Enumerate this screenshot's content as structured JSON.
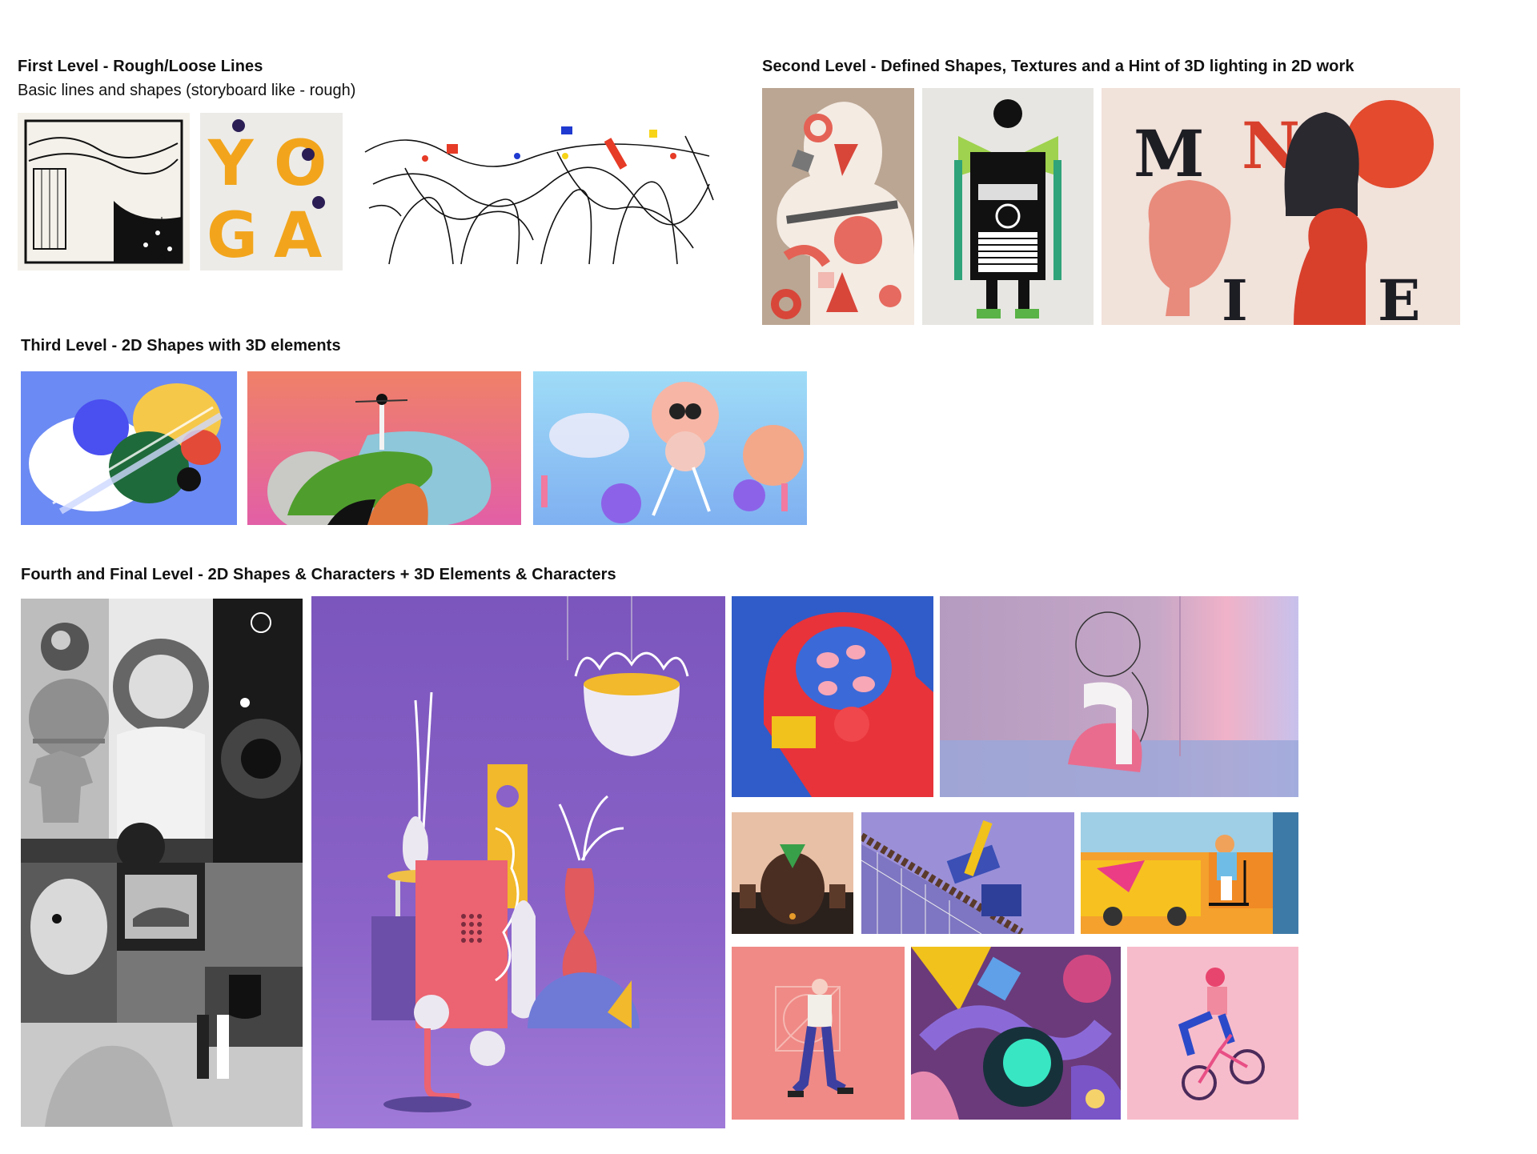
{
  "levels": {
    "first": {
      "title": "First Level - Rough/Loose Lines",
      "subtitle": "Basic lines and shapes (storyboard like - rough)",
      "art_letters": [
        "Y",
        "O",
        "G",
        "A"
      ]
    },
    "second": {
      "title": "Second Level - Defined Shapes, Textures and a Hint of 3D lighting in 2D work",
      "art_letters": [
        "M",
        "N",
        "I",
        "E"
      ]
    },
    "third": {
      "title": "Third Level - 2D Shapes with 3D elements"
    },
    "fourth": {
      "title": "Fourth and Final Level - 2D Shapes & Characters + 3D Elements & Characters"
    }
  }
}
